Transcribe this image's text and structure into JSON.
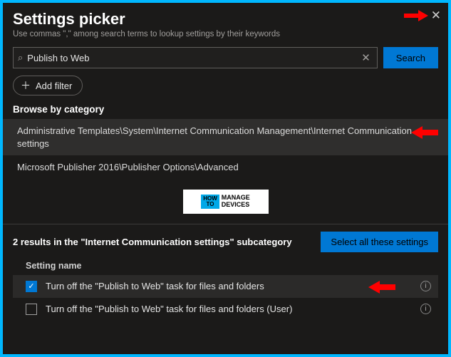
{
  "header": {
    "title": "Settings picker",
    "subtitle": "Use commas \",\" among search terms to lookup settings by their keywords"
  },
  "search": {
    "value": "Publish to Web",
    "button": "Search"
  },
  "add_filter_label": "Add filter",
  "browse_heading": "Browse by category",
  "categories": [
    "Administrative Templates\\System\\Internet Communication Management\\Internet Communication settings",
    "Microsoft Publisher 2016\\Publisher Options\\Advanced"
  ],
  "watermark": {
    "left": "HOW\nTO",
    "right": "MANAGE\nDEVICES"
  },
  "results_summary": "2 results in the \"Internet Communication settings\" subcategory",
  "select_all_label": "Select all these settings",
  "column_header": "Setting name",
  "settings": [
    {
      "label": "Turn off the \"Publish to Web\" task for files and folders",
      "checked": true
    },
    {
      "label": "Turn off the \"Publish to Web\" task for files and folders (User)",
      "checked": false
    }
  ]
}
